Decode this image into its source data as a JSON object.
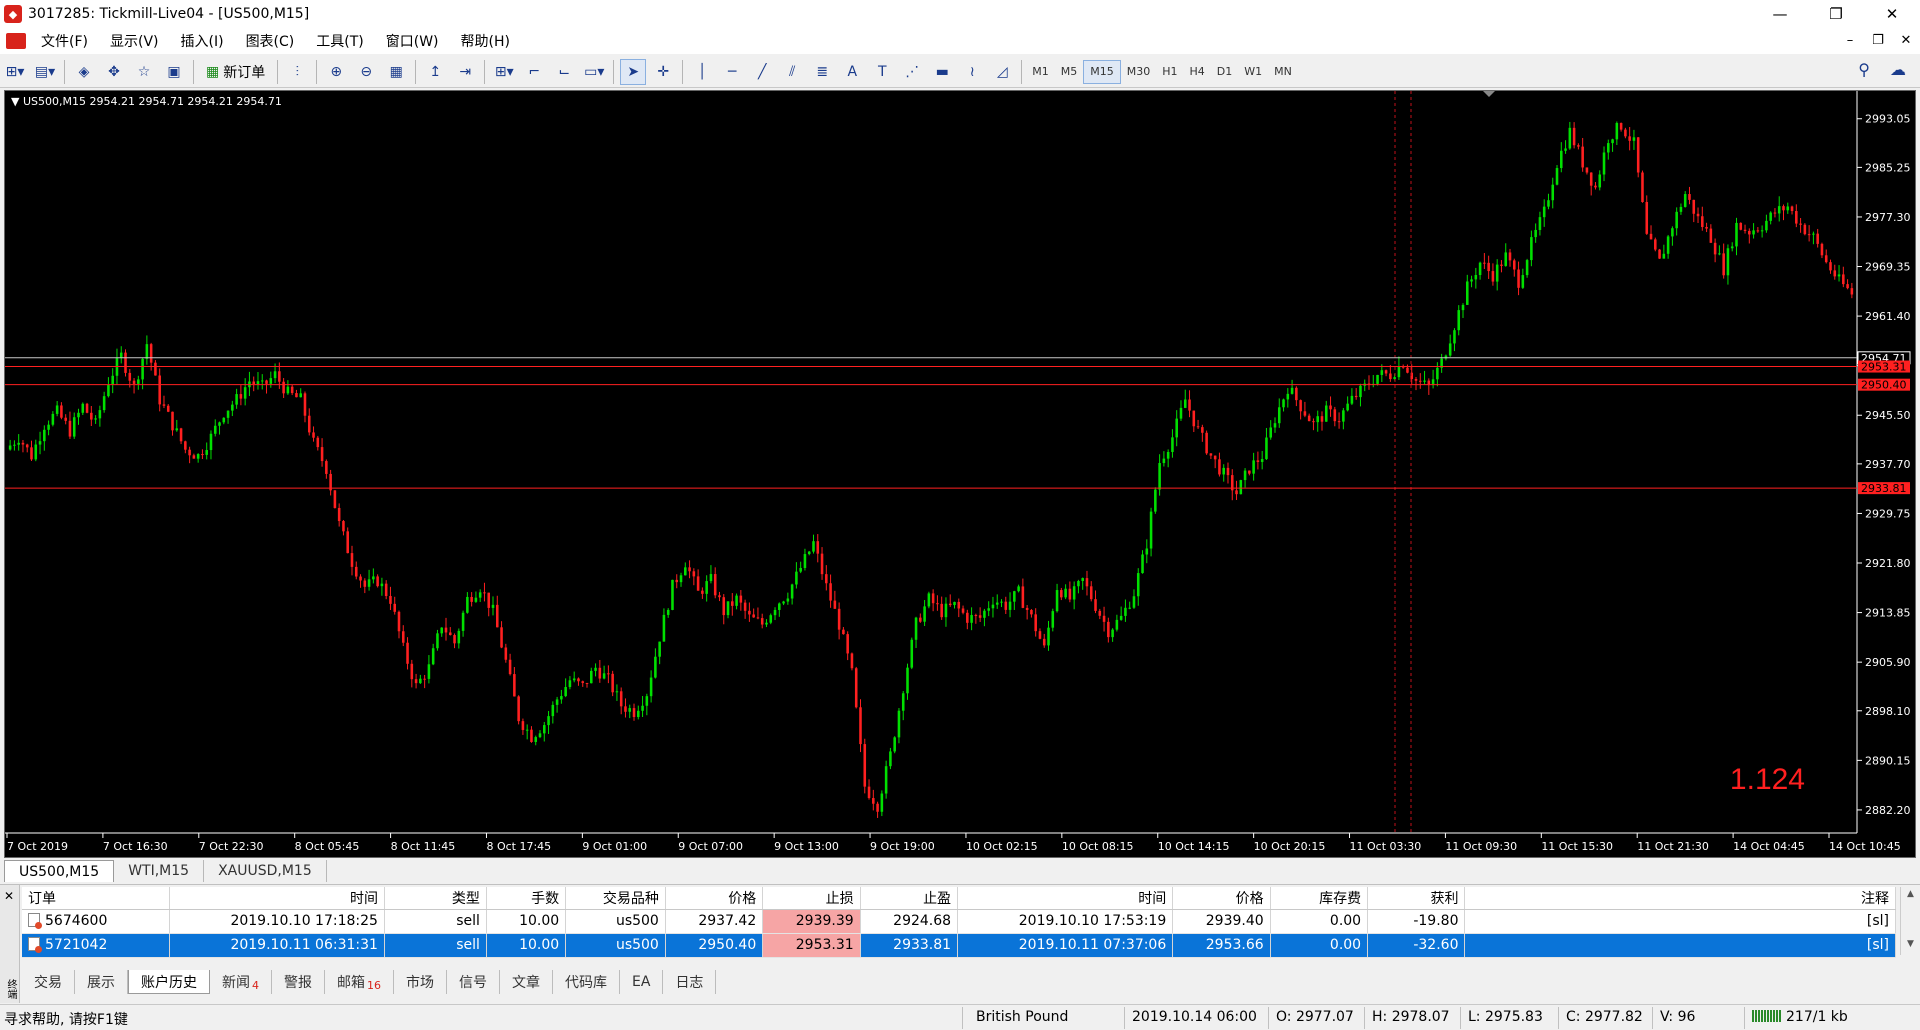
{
  "window": {
    "title": "3017285: Tickmill-Live04 - [US500,M15]",
    "app_icon": "metatrader-icon",
    "buttons": {
      "minimize": "—",
      "restore": "❐",
      "close": "✕"
    }
  },
  "menu": {
    "items": [
      "文件(F)",
      "显示(V)",
      "插入(I)",
      "图表(C)",
      "工具(T)",
      "窗口(W)",
      "帮助(H)"
    ],
    "mdi_buttons": {
      "minimize": "–",
      "restore": "❐",
      "close": "✕"
    }
  },
  "toolbar": {
    "new_order_label": "新订单",
    "timeframes": [
      "M1",
      "M5",
      "M15",
      "M30",
      "H1",
      "H4",
      "D1",
      "W1",
      "MN"
    ],
    "active_timeframe": "M15",
    "text_tool": "A"
  },
  "chart": {
    "header": "▼ US500,M15  2954.21  2954.71  2954.21  2954.71",
    "spread": "1.124",
    "background": "#000000",
    "bull_color": "#00e000",
    "bear_color": "#ff2020",
    "price_axis": [
      "2993.05",
      "2985.25",
      "2977.30",
      "2969.35",
      "2961.40",
      "2953.45",
      "2945.50",
      "2937.70",
      "2929.75",
      "2921.80",
      "2913.85",
      "2905.90",
      "2898.10",
      "2890.15",
      "2882.20"
    ],
    "price_labels": [
      {
        "text": "2954.71",
        "price": 2954.71,
        "color": "#ffffff",
        "bg": "#000000"
      },
      {
        "text": "2953.31",
        "price": 2953.31,
        "color": "#000000",
        "bg": "#ff2020"
      },
      {
        "text": "2950.40",
        "price": 2950.4,
        "color": "#000000",
        "bg": "#ff2020"
      },
      {
        "text": "2933.81",
        "price": 2933.81,
        "color": "#000000",
        "bg": "#ff2020"
      }
    ],
    "time_axis": [
      "7 Oct 2019",
      "7 Oct 16:30",
      "7 Oct 22:30",
      "8 Oct 05:45",
      "8 Oct 11:45",
      "8 Oct 17:45",
      "9 Oct 01:00",
      "9 Oct 07:00",
      "9 Oct 13:00",
      "9 Oct 19:00",
      "10 Oct 02:15",
      "10 Oct 08:15",
      "10 Oct 14:15",
      "10 Oct 20:15",
      "11 Oct 03:30",
      "11 Oct 09:30",
      "11 Oct 15:30",
      "11 Oct 21:30",
      "14 Oct 04:45",
      "14 Oct 10:45"
    ]
  },
  "chart_data": {
    "type": "candlestick",
    "title": "US500,M15",
    "ylim": [
      2878.5,
      2997.5
    ],
    "path_points": [
      2940,
      2942,
      2939,
      2944,
      2946,
      2943,
      2947,
      2944,
      2951,
      2955,
      2950,
      2957,
      2948,
      2944,
      2940,
      2939,
      2942,
      2946,
      2948,
      2951,
      2950,
      2952,
      2949,
      2948,
      2941,
      2937,
      2928,
      2922,
      2918,
      2919,
      2916,
      2908,
      2902,
      2905,
      2912,
      2909,
      2916,
      2918,
      2914,
      2906,
      2897,
      2894,
      2896,
      2900,
      2903,
      2902,
      2905,
      2903,
      2899,
      2898,
      2901,
      2910,
      2918,
      2922,
      2917,
      2919,
      2914,
      2916,
      2913,
      2912,
      2915,
      2917,
      2921,
      2925,
      2918,
      2912,
      2904,
      2886,
      2883,
      2891,
      2902,
      2912,
      2916,
      2914,
      2915,
      2913,
      2913,
      2916,
      2915,
      2917,
      2913,
      2908,
      2918,
      2916,
      2919,
      2915,
      2911,
      2913,
      2917,
      2925,
      2938,
      2942,
      2948,
      2943,
      2939,
      2936,
      2933,
      2937,
      2939,
      2945,
      2950,
      2947,
      2944,
      2946,
      2945,
      2948,
      2950,
      2952,
      2952,
      2954,
      2951,
      2950,
      2954,
      2960,
      2966,
      2970,
      2968,
      2971,
      2967,
      2973,
      2978,
      2986,
      2991,
      2986,
      2982,
      2990,
      2992,
      2989,
      2974,
      2970,
      2976,
      2981,
      2977,
      2974,
      2969,
      2976,
      2975,
      2976,
      2978,
      2979,
      2976,
      2974,
      2970,
      2967,
      2965
    ],
    "horizontal_lines": [
      2953.31,
      2950.4,
      2933.81
    ],
    "current_price": 2954.71
  },
  "chart_tabs": [
    "US500,M15",
    "WTI,M15",
    "XAUUSD,M15"
  ],
  "orders": {
    "columns": [
      "订单",
      "时间",
      "类型",
      "手数",
      "交易品种",
      "价格",
      "止损",
      "止盈",
      "时间",
      "价格",
      "库存费",
      "获利",
      "注释"
    ],
    "rows": [
      [
        "5674600",
        "2019.10.10 17:18:25",
        "sell",
        "10.00",
        "us500",
        "2937.42",
        "2939.39",
        "2924.68",
        "2019.10.10 17:53:19",
        "2939.40",
        "0.00",
        "-19.80",
        "[sl]"
      ],
      [
        "5721042",
        "2019.10.11 06:31:31",
        "sell",
        "10.00",
        "us500",
        "2950.40",
        "2953.31",
        "2933.81",
        "2019.10.11 07:37:06",
        "2953.66",
        "0.00",
        "-32.60",
        "[sl]"
      ]
    ],
    "selected_row": 1
  },
  "terminal_tabs": [
    {
      "label": "交易",
      "badge": ""
    },
    {
      "label": "展示",
      "badge": ""
    },
    {
      "label": "账户历史",
      "badge": "",
      "active": true
    },
    {
      "label": "新闻",
      "badge": "4"
    },
    {
      "label": "警报",
      "badge": ""
    },
    {
      "label": "邮箱",
      "badge": "16"
    },
    {
      "label": "市场",
      "badge": ""
    },
    {
      "label": "信号",
      "badge": ""
    },
    {
      "label": "文章",
      "badge": ""
    },
    {
      "label": "代码库",
      "badge": ""
    },
    {
      "label": "EA",
      "badge": ""
    },
    {
      "label": "日志",
      "badge": ""
    }
  ],
  "terminal_side_label": "终端",
  "status": {
    "help": "寻求帮助, 请按F1键",
    "profile": "British Pound",
    "datetime": "2019.10.14 06:00",
    "open": "O: 2977.07",
    "high": "H: 2978.07",
    "low": "L: 2975.83",
    "close": "C: 2977.82",
    "volume": "V: 96",
    "connection": "217/1 kb"
  }
}
